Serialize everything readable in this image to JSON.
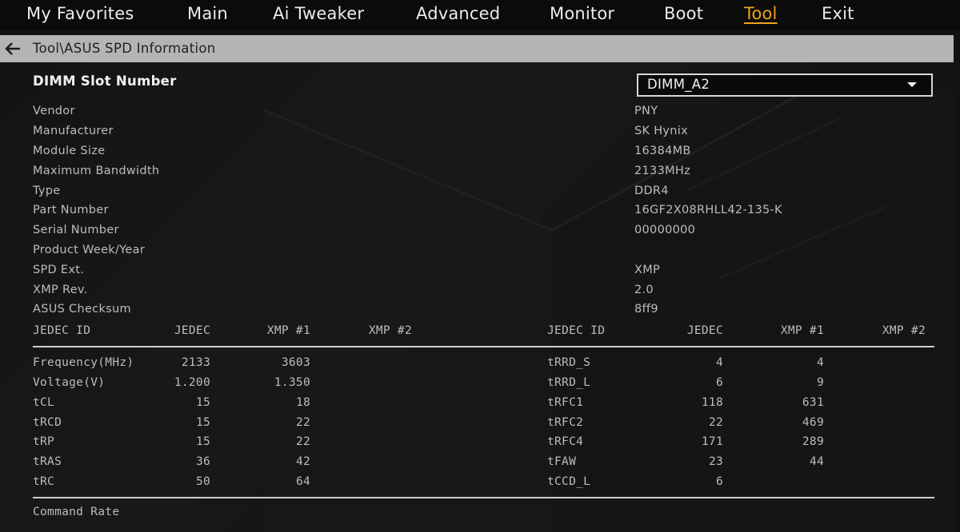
{
  "nav": {
    "tabs": [
      {
        "label": "My Favorites"
      },
      {
        "label": "Main"
      },
      {
        "label": "Ai Tweaker"
      },
      {
        "label": "Advanced"
      },
      {
        "label": "Monitor"
      },
      {
        "label": "Boot"
      },
      {
        "label": "Tool"
      },
      {
        "label": "Exit"
      }
    ],
    "active_tab": "Tool"
  },
  "path": "Tool\\ASUS SPD Information",
  "slot": {
    "label": "DIMM Slot Number",
    "value": "DIMM_A2"
  },
  "info": [
    {
      "label": "Vendor",
      "value": "PNY"
    },
    {
      "label": "Manufacturer",
      "value": "SK Hynix"
    },
    {
      "label": "Module Size",
      "value": "16384MB"
    },
    {
      "label": "Maximum Bandwidth",
      "value": "2133MHz"
    },
    {
      "label": "Type",
      "value": "DDR4"
    },
    {
      "label": "Part Number",
      "value": "16GF2X08RHLL42-135-K"
    },
    {
      "label": "Serial Number",
      "value": "00000000"
    },
    {
      "label": "Product Week/Year",
      "value": ""
    },
    {
      "label": "SPD Ext.",
      "value": "XMP"
    },
    {
      "label": "XMP Rev.",
      "value": "2.0"
    },
    {
      "label": "ASUS Checksum",
      "value": "8ff9"
    }
  ],
  "timing_headers": {
    "left": [
      "JEDEC ID",
      "JEDEC",
      "XMP #1",
      "XMP #2"
    ],
    "right": [
      "JEDEC ID",
      "JEDEC",
      "XMP #1",
      "XMP #2"
    ]
  },
  "timings_left": [
    {
      "name": "Frequency(MHz)",
      "jedec": "2133",
      "xmp1": "3603",
      "xmp2": ""
    },
    {
      "name": "Voltage(V)",
      "jedec": "1.200",
      "xmp1": "1.350",
      "xmp2": ""
    },
    {
      "name": "tCL",
      "jedec": "15",
      "xmp1": "18",
      "xmp2": ""
    },
    {
      "name": "tRCD",
      "jedec": "15",
      "xmp1": "22",
      "xmp2": ""
    },
    {
      "name": "tRP",
      "jedec": "15",
      "xmp1": "22",
      "xmp2": ""
    },
    {
      "name": "tRAS",
      "jedec": "36",
      "xmp1": "42",
      "xmp2": ""
    },
    {
      "name": "tRC",
      "jedec": "50",
      "xmp1": "64",
      "xmp2": ""
    }
  ],
  "timings_right": [
    {
      "name": "tRRD_S",
      "jedec": "4",
      "xmp1": "4",
      "xmp2": ""
    },
    {
      "name": "tRRD_L",
      "jedec": "6",
      "xmp1": "9",
      "xmp2": ""
    },
    {
      "name": "tRFC1",
      "jedec": "118",
      "xmp1": "631",
      "xmp2": ""
    },
    {
      "name": "tRFC2",
      "jedec": "22",
      "xmp1": "469",
      "xmp2": ""
    },
    {
      "name": "tRFC4",
      "jedec": "171",
      "xmp1": "289",
      "xmp2": ""
    },
    {
      "name": "tFAW",
      "jedec": "23",
      "xmp1": "44",
      "xmp2": ""
    },
    {
      "name": "tCCD_L",
      "jedec": "6",
      "xmp1": "",
      "xmp2": ""
    }
  ],
  "footer_row": "Command Rate",
  "colors": {
    "active_tab": "#f0a21c",
    "path_bar": "#b4b4b4",
    "background": "#141414"
  },
  "icons": {
    "back": "back-arrow-icon",
    "dropdown": "chevron-down-icon"
  }
}
